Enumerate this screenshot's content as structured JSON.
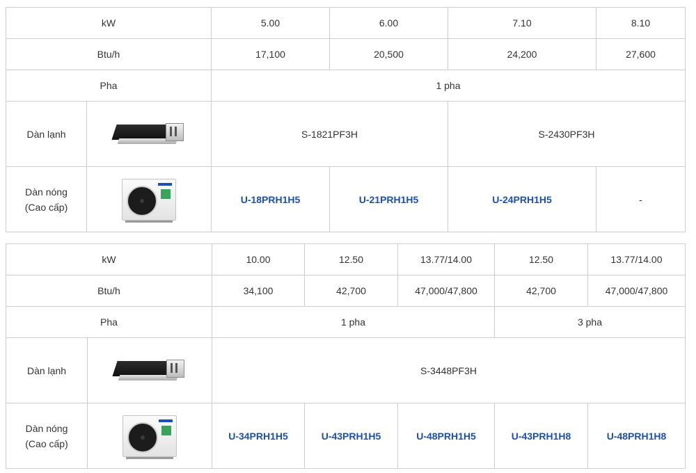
{
  "table1": {
    "kw_label": "kW",
    "kw": [
      "5.00",
      "6.00",
      "7.10",
      "8.10"
    ],
    "btu_label": "Btu/h",
    "btu": [
      "17,100",
      "20,500",
      "24,200",
      "27,600"
    ],
    "phase_label": "Pha",
    "phase": "1 pha",
    "indoor_label": "Dàn lạnh",
    "indoor_models": [
      "S-1821PF3H",
      "S-2430PF3H"
    ],
    "outdoor_label_line1": "Dàn nóng",
    "outdoor_label_line2": "(Cao cấp)",
    "outdoor_models": [
      "U-18PRH1H5",
      "U-21PRH1H5",
      "U-24PRH1H5",
      "-"
    ]
  },
  "table2": {
    "kw_label": "kW",
    "kw": [
      "10.00",
      "12.50",
      "13.77/14.00",
      "12.50",
      "13.77/14.00"
    ],
    "btu_label": "Btu/h",
    "btu": [
      "34,100",
      "42,700",
      "47,000/47,800",
      "42,700",
      "47,000/47,800"
    ],
    "phase_label": "Pha",
    "phases": [
      "1 pha",
      "3 pha"
    ],
    "indoor_label": "Dàn lạnh",
    "indoor_model": "S-3448PF3H",
    "outdoor_label_line1": "Dàn nóng",
    "outdoor_label_line2": "(Cao cấp)",
    "outdoor_models": [
      "U-34PRH1H5",
      "U-43PRH1H5",
      "U-48PRH1H5",
      "U-43PRH1H8",
      "U-48PRH1H8"
    ]
  },
  "images": {
    "indoor": "ducted-indoor-unit-image",
    "outdoor": "outdoor-unit-image"
  },
  "colors": {
    "model_link": "#1a4fb3",
    "border": "#cccccc",
    "text": "#333333"
  }
}
